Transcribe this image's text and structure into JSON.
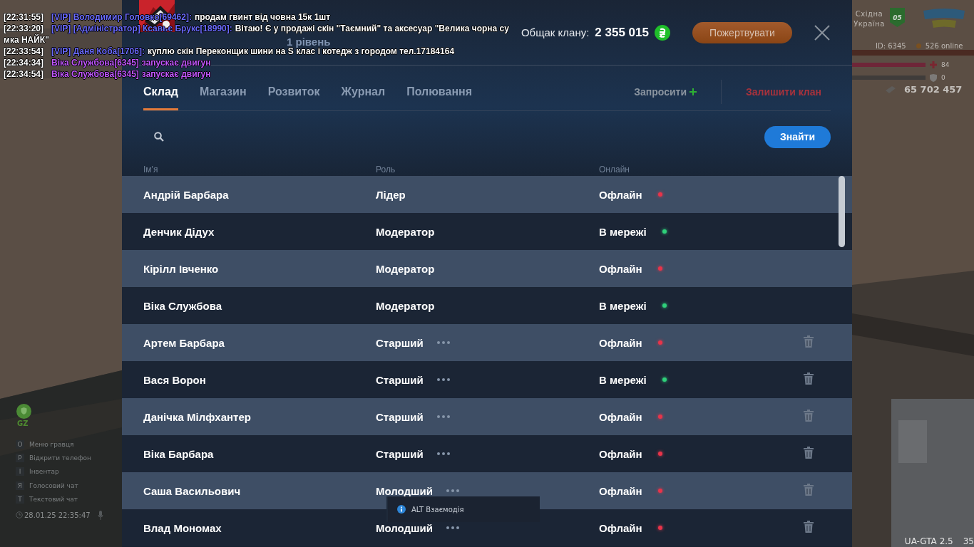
{
  "chat": [
    {
      "time": "[22:31:55]",
      "sender": "[VIP] Володимир Головко[69462]:",
      "message": "продам гвинт від човна 15к 1шт",
      "kind": "message"
    },
    {
      "time": "[22:33:20]",
      "sender": "[VIP] [Адміністратор] Ксавьє Брукс[18990]:",
      "message": "Вітаю! Є у продажі скін \"Таємний\" та аксесуар \"Велика чорна су",
      "continuation": "мка НАЙК\"",
      "kind": "message"
    },
    {
      "time": "[22:33:54]",
      "sender": "[VIP] Даня Коба[1706]:",
      "message": "куплю скін Переконщик шини на S клас і котедж з городом тел.17184164",
      "kind": "message"
    },
    {
      "time": "[22:34:34]",
      "sender": "Віка Службова[6345]",
      "message": "запускає двигун",
      "kind": "action"
    },
    {
      "time": "[22:34:54]",
      "sender": "Віка Службова[6345]",
      "message": "запускає двигун",
      "kind": "action"
    }
  ],
  "clan": {
    "level": "1 рівень",
    "treasury_label": "Общак клану:",
    "treasury": "2 355 015",
    "donate": "Пожертвувати"
  },
  "tabs": [
    {
      "label": "Склад",
      "selected": true
    },
    {
      "label": "Магазин",
      "selected": false
    },
    {
      "label": "Розвиток",
      "selected": false
    },
    {
      "label": "Журнал",
      "selected": false
    },
    {
      "label": "Полювання",
      "selected": false
    }
  ],
  "actions": {
    "invite": "Запросити",
    "leave": "Залишити клан"
  },
  "search": {
    "button": "Знайти"
  },
  "columns": [
    "Ім'я",
    "Роль",
    "Онлайн"
  ],
  "rows": [
    {
      "name": "Андрій Барбара",
      "role": "Лідер",
      "status": "Офлайн",
      "online": false,
      "menu": false,
      "removable": false
    },
    {
      "name": "Денчик Дідух",
      "role": "Модератор",
      "status": "В мережі",
      "online": true,
      "menu": false,
      "removable": false
    },
    {
      "name": "Кірілл Івченко",
      "role": "Модератор",
      "status": "Офлайн",
      "online": false,
      "menu": false,
      "removable": false
    },
    {
      "name": "Віка Службова",
      "role": "Модератор",
      "status": "В мережі",
      "online": true,
      "menu": false,
      "removable": false
    },
    {
      "name": "Артем Барбара",
      "role": "Старший",
      "status": "Офлайн",
      "online": false,
      "menu": true,
      "removable": true
    },
    {
      "name": "Вася Ворон",
      "role": "Старший",
      "status": "В мережі",
      "online": true,
      "menu": true,
      "removable": true
    },
    {
      "name": "Данічка Мілфхантер",
      "role": "Старший",
      "status": "Офлайн",
      "online": false,
      "menu": true,
      "removable": true
    },
    {
      "name": "Віка Барбара",
      "role": "Старший",
      "status": "Офлайн",
      "online": false,
      "menu": true,
      "removable": true
    },
    {
      "name": "Саша Васильович",
      "role": "Молодший",
      "status": "Офлайн",
      "online": false,
      "menu": true,
      "removable": true
    },
    {
      "name": "Влад Мономах",
      "role": "Молодший",
      "status": "Офлайн",
      "online": false,
      "menu": true,
      "removable": true
    }
  ],
  "hud_left": {
    "tag": "GZ",
    "keys": [
      {
        "key": "О",
        "label": "Меню гравця"
      },
      {
        "key": "Р",
        "label": "Відкрити телефон"
      },
      {
        "key": "І",
        "label": "Інвентар"
      },
      {
        "key": "Я",
        "label": "Голосовий чат"
      },
      {
        "key": "Т",
        "label": "Текстовий чат"
      }
    ],
    "datetime": "28.01.25 22:35:47"
  },
  "hud_right": {
    "region": [
      "Східна",
      "Україна"
    ],
    "badge": "05",
    "id": "ID: 6345",
    "online": "526 online",
    "health": {
      "level": 1,
      "reading": "84"
    },
    "armor": {
      "level": 0,
      "reading": "0"
    },
    "money": "65 702 457"
  },
  "toast": {
    "text": "ALT Взаємодія"
  },
  "version": {
    "name": "UA-GTA 2.5",
    "fps": "35"
  }
}
